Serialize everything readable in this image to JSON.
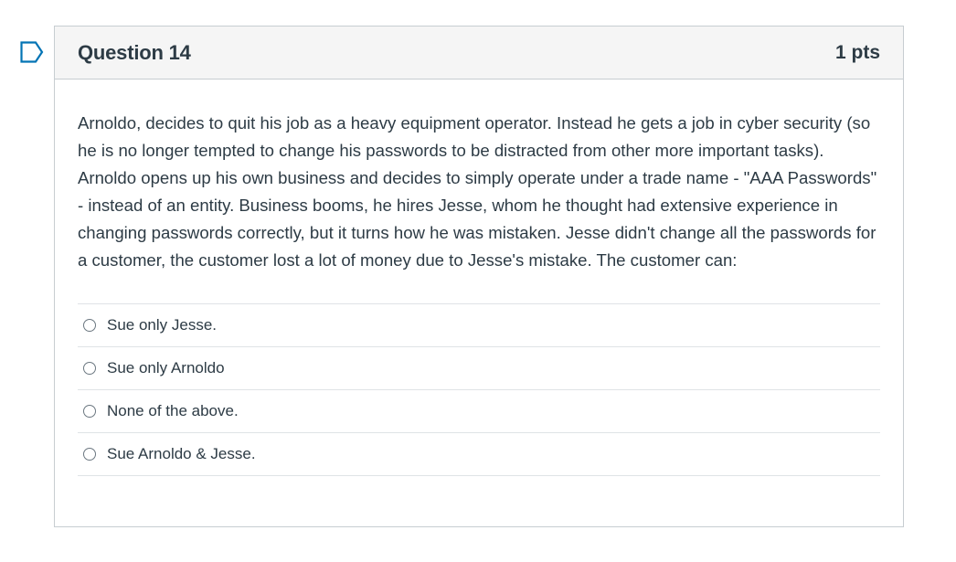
{
  "flag": {
    "icon": "flag-bookmark-icon",
    "color": "#0374b5"
  },
  "question": {
    "title": "Question 14",
    "points": "1 pts",
    "text": "Arnoldo, decides to quit his job as a heavy equipment operator.  Instead he gets a job in cyber security (so he is no longer tempted to change his passwords to be distracted from other more important tasks).  Arnoldo opens up his own business and decides to simply operate under a trade name - \"AAA Passwords\" - instead of an entity.  Business booms, he hires Jesse, whom he thought had extensive experience in changing passwords correctly, but it turns how he was mistaken.  Jesse didn't change all the passwords for a customer, the customer lost a lot of money due to Jesse's mistake.  The customer can:"
  },
  "answers": [
    {
      "label": "Sue only Jesse.",
      "selected": false
    },
    {
      "label": "Sue only Arnoldo",
      "selected": false
    },
    {
      "label": "None of the above.",
      "selected": false
    },
    {
      "label": "Sue Arnoldo & Jesse.",
      "selected": false
    }
  ]
}
